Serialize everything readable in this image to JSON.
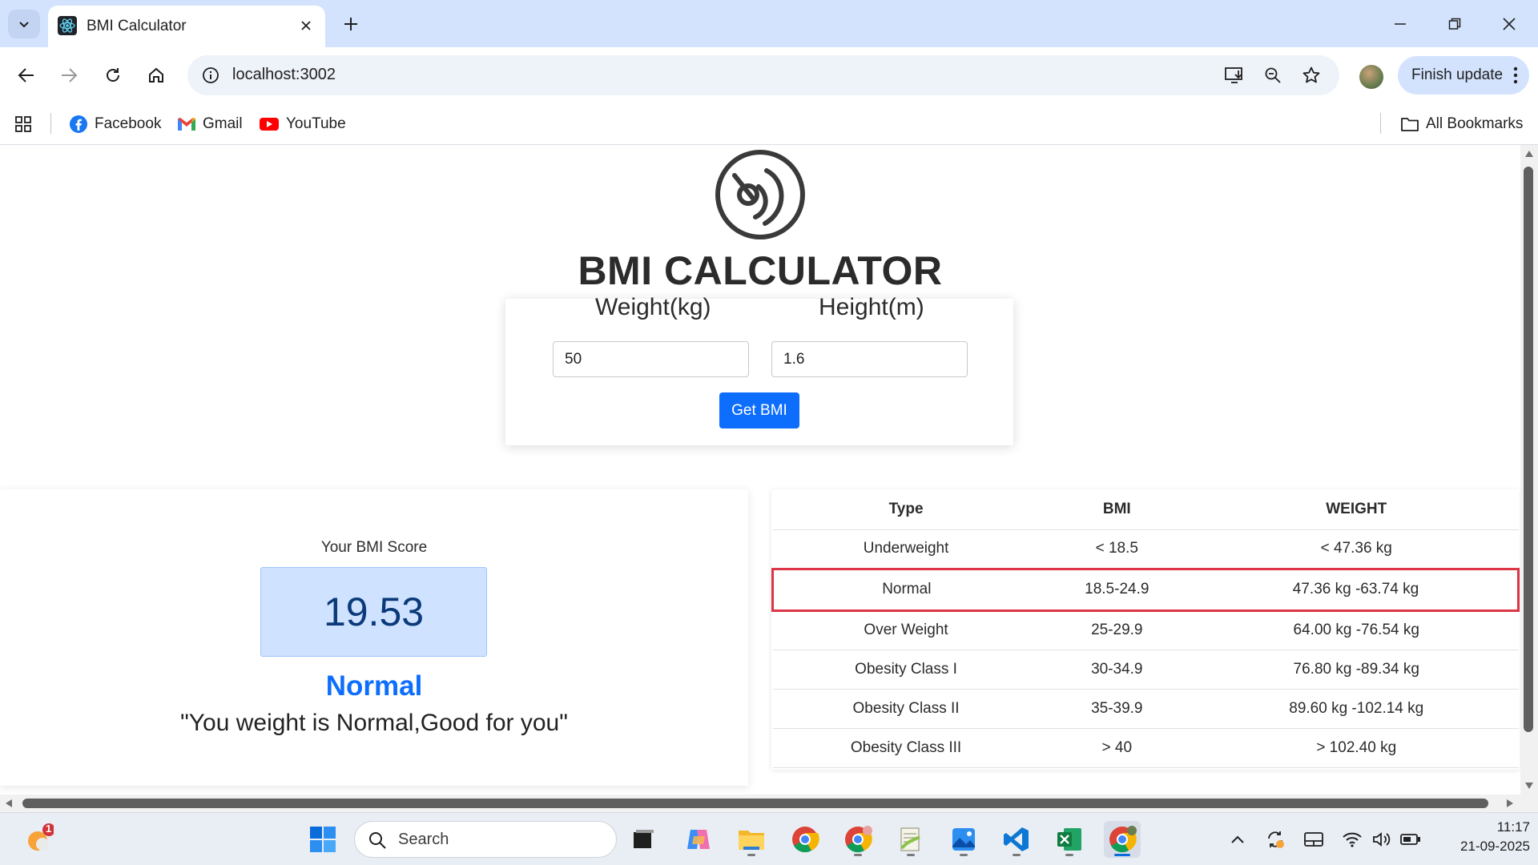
{
  "browser": {
    "tab_title": "BMI Calculator",
    "url": "localhost:3002",
    "finish_update_label": "Finish update",
    "bookmarks": [
      {
        "label": "Facebook",
        "icon": "facebook-icon"
      },
      {
        "label": "Gmail",
        "icon": "gmail-icon"
      },
      {
        "label": "YouTube",
        "icon": "youtube-icon"
      }
    ],
    "all_bookmarks_label": "All Bookmarks"
  },
  "app": {
    "title": "BMI CALCULATOR",
    "weight_label": "Weight(kg)",
    "height_label": "Height(m)",
    "weight_value": "50",
    "height_value": "1.6",
    "button_label": "Get BMI",
    "score_label": "Your BMI Score",
    "score": "19.53",
    "category": "Normal",
    "message": "\"You weight is Normal,Good for you\""
  },
  "table": {
    "headers": [
      "Type",
      "BMI",
      "WEIGHT"
    ],
    "rows": [
      [
        "Underweight",
        "< 18.5",
        "< 47.36 kg"
      ],
      [
        "Normal",
        "18.5-24.9",
        "47.36 kg -63.74 kg"
      ],
      [
        "Over Weight",
        "25-29.9",
        "64.00 kg -76.54 kg"
      ],
      [
        "Obesity Class I",
        "30-34.9",
        "76.80 kg -89.34 kg"
      ],
      [
        "Obesity Class II",
        "35-39.9",
        "89.60 kg -102.14 kg"
      ],
      [
        "Obesity Class III",
        "> 40",
        "> 102.40 kg"
      ]
    ],
    "highlighted_row": 1
  },
  "taskbar": {
    "search_placeholder": "Search",
    "time": "11:17",
    "date": "21-09-2025",
    "widget_badge": "1"
  },
  "colors": {
    "accent": "#0d6efd",
    "highlight_border": "#dc3545",
    "score_bg": "#cfe2ff",
    "tabstrip": "#d3e3fd"
  }
}
